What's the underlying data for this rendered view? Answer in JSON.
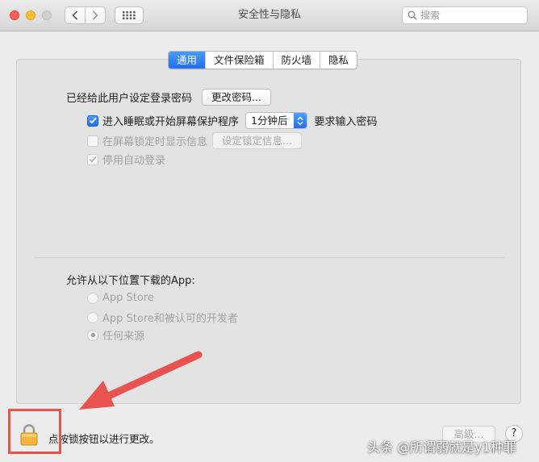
{
  "window": {
    "title": "安全性与隐私",
    "search_placeholder": "搜索"
  },
  "tabs": [
    {
      "label": "通用",
      "active": true
    },
    {
      "label": "文件保险箱",
      "active": false
    },
    {
      "label": "防火墙",
      "active": false
    },
    {
      "label": "隐私",
      "active": false
    }
  ],
  "general": {
    "password_label": "已经给此用户设定登录密码",
    "change_password_button": "更改密码...",
    "require_password": {
      "checked": true,
      "label": "进入睡眠或开始屏幕保护程序",
      "delay_value": "1分钟后",
      "suffix": "要求输入密码"
    },
    "lock_message": {
      "checked": false,
      "enabled": false,
      "label": "在屏幕锁定时显示信息",
      "button": "设定锁定信息..."
    },
    "disable_autologin": {
      "checked": true,
      "enabled": false,
      "label": "停用自动登录"
    }
  },
  "downloads": {
    "heading": "允许从以下位置下载的App:",
    "options": [
      {
        "label": "App Store",
        "selected": false
      },
      {
        "label": "App Store和被认可的开发者",
        "selected": false
      },
      {
        "label": "任何来源",
        "selected": true
      }
    ]
  },
  "footer": {
    "lock_label": "点按锁按钮以进行更改。",
    "advanced_button": "高级...",
    "help_button": "?"
  },
  "watermark": "头条 @所谓弱就是y1种罪",
  "colors": {
    "accent_blue": "#1f6ff1",
    "annotation_red": "#e8534f",
    "lock_gold": "#f2b540"
  }
}
